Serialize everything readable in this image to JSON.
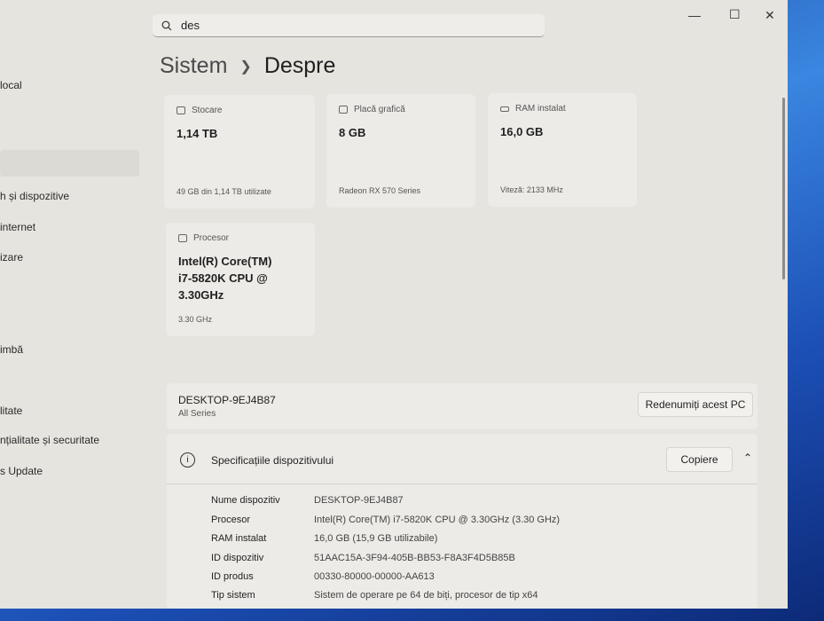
{
  "search": {
    "value": "des"
  },
  "sidebar": {
    "items": [
      "local",
      "h și dispozitive",
      "internet",
      "izare",
      "imbă",
      "litate",
      "nțialitate și securitate",
      "s Update"
    ]
  },
  "header": {
    "parent": "Sistem",
    "current": "Despre"
  },
  "cards": [
    {
      "label": "Stocare",
      "value": "1,14 TB",
      "sub": "49 GB din 1,14 TB utilizate"
    },
    {
      "label": "Placă grafică",
      "value": "8 GB",
      "sub": "Radeon RX 570 Series"
    },
    {
      "label": "RAM instalat",
      "value": "16,0 GB",
      "sub": "Viteză: 2133 MHz"
    },
    {
      "label": "Procesor",
      "value": "Intel(R) Core(TM) i7-5820K CPU @ 3.30GHz",
      "sub": "3.30 GHz"
    }
  ],
  "device": {
    "name": "DESKTOP-9EJ4B87",
    "model": "All Series",
    "rename_label": "Redenumiți acest PC"
  },
  "specs": {
    "title": "Specificațiile dispozitivului",
    "copy_label": "Copiere",
    "rows": [
      {
        "k": "Nume dispozitiv",
        "v": "DESKTOP-9EJ4B87"
      },
      {
        "k": "Procesor",
        "v": "Intel(R) Core(TM) i7-5820K CPU @ 3.30GHz (3.30 GHz)"
      },
      {
        "k": "RAM instalat",
        "v": "16,0 GB (15,9 GB utilizabile)"
      },
      {
        "k": "ID dispozitiv",
        "v": "51AAC15A-3F94-405B-BB53-F8A3F4D5B85B"
      },
      {
        "k": "ID produs",
        "v": "00330-80000-00000-AA613"
      },
      {
        "k": "Tip sistem",
        "v": "Sistem de operare pe 64 de biți, procesor de tip x64"
      }
    ]
  }
}
